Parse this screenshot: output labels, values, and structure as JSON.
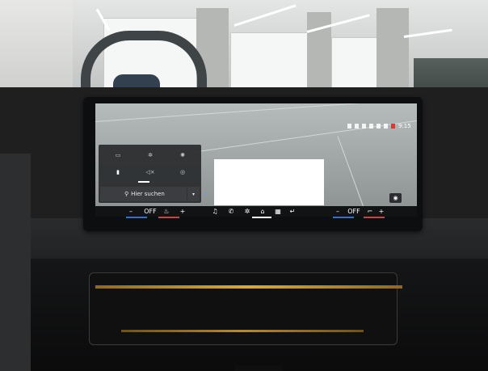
{
  "screen": {
    "map_logo_text": "",
    "status": {
      "clock": "9:15"
    },
    "quick_panel": {
      "buttons": [
        {
          "name": "quick-btn-1",
          "icon": "seat-icon"
        },
        {
          "name": "quick-btn-2",
          "icon": "fan-icon"
        },
        {
          "name": "quick-btn-3",
          "icon": "light-icon"
        },
        {
          "name": "quick-btn-4",
          "icon": "fuel-icon"
        },
        {
          "name": "quick-btn-5",
          "icon": "mute-icon"
        },
        {
          "name": "quick-btn-6",
          "icon": "settings-icon"
        }
      ],
      "search_placeholder": "Hier suchen",
      "search_icon": "search-icon",
      "dropdown_icon": "chevron-down-icon"
    },
    "right_button_icon": "camera-icon",
    "bottom_bar": {
      "left_minus": "–",
      "left_status": "OFF",
      "left_plus": "+",
      "right_minus": "–",
      "right_status": "OFF",
      "right_plus": "+",
      "media_icons": [
        "music-icon",
        "phone-icon",
        "fan-icon",
        "home-icon",
        "apps-icon",
        "back-icon"
      ]
    },
    "colors": {
      "accent_blue": "#2f6fe0",
      "accent_red": "#e03a3a",
      "status_record": "#d43b34"
    }
  }
}
